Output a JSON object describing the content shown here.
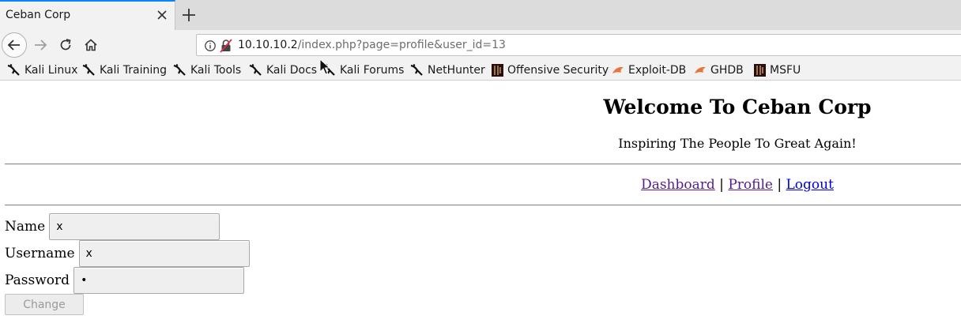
{
  "browser": {
    "tab_title": "Ceban Corp",
    "url_host": "10.10.10.2",
    "url_rest": "/index.php?page=profile&user_id=13",
    "bookmarks": [
      {
        "label": "Kali Linux",
        "icon": "kali-dragon-icon"
      },
      {
        "label": "Kali Training",
        "icon": "kali-dragon-icon"
      },
      {
        "label": "Kali Tools",
        "icon": "kali-dragon-icon"
      },
      {
        "label": "Kali Docs",
        "icon": "kali-dragon-icon"
      },
      {
        "label": "Kali Forums",
        "icon": "kali-dragon-icon"
      },
      {
        "label": "NetHunter",
        "icon": "kali-dragon-icon"
      },
      {
        "label": "Offensive Security",
        "icon": "offsec-icon"
      },
      {
        "label": "Exploit-DB",
        "icon": "exploitdb-icon"
      },
      {
        "label": "GHDB",
        "icon": "exploitdb-icon"
      },
      {
        "label": "MSFU",
        "icon": "offsec-icon"
      }
    ]
  },
  "page": {
    "title": "Welcome To Ceban Corp",
    "subtitle": "Inspiring The People To Great Again!",
    "nav": {
      "dashboard": "Dashboard",
      "profile": "Profile",
      "logout": "Logout",
      "separator": "|"
    },
    "form": {
      "name_label": "Name",
      "name_value": "x",
      "username_label": "Username",
      "username_value": "x",
      "password_label": "Password",
      "password_value": "x",
      "submit_label": "Change"
    }
  },
  "colors": {
    "tab_accent": "#0a84ff",
    "visited_link": "#551a8b",
    "link": "#0000ee"
  }
}
